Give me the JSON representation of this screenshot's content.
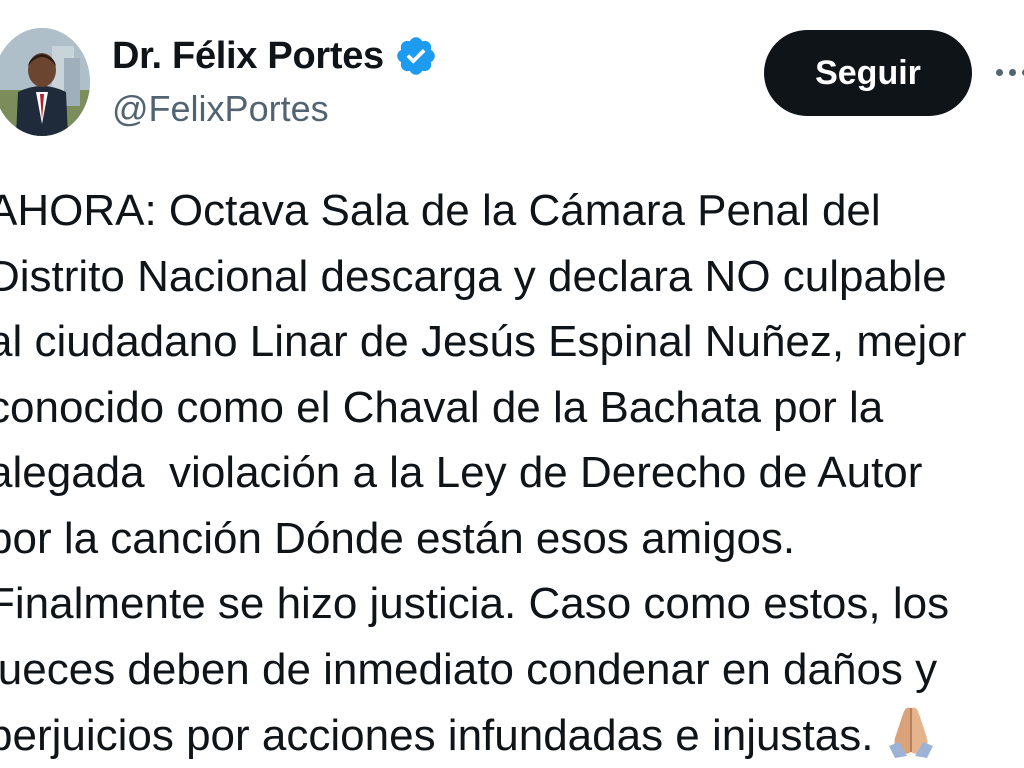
{
  "author": {
    "display_name": "Dr. Félix Portes",
    "handle": "@FelixPortes",
    "verified": true,
    "avatar_icon": "profile-photo"
  },
  "actions": {
    "follow_label": "Seguir",
    "more_icon": "more-options-icon"
  },
  "tweet": {
    "lines": [
      "AHORA: Octava Sala de la Cámara Penal del",
      "Distrito Nacional descarga y declara NO culpable",
      "al ciudadano Linar de Jesús Espinal Nuñez, mejor",
      "conocido como el Chaval de la Bachata por la",
      "alegada  violación a la Ley de Derecho de Autor",
      "por la canción Dónde están esos amigos.",
      "Finalmente se hizo justicia. Caso como estos, los",
      "jueces deben de inmediato condenar en daños y",
      "perjuicios por acciones infundadas e injustas."
    ],
    "emoji": "folded-hands"
  },
  "colors": {
    "verified": "#1d9bf0",
    "follow_bg": "#0f1419",
    "handle": "#536471"
  }
}
